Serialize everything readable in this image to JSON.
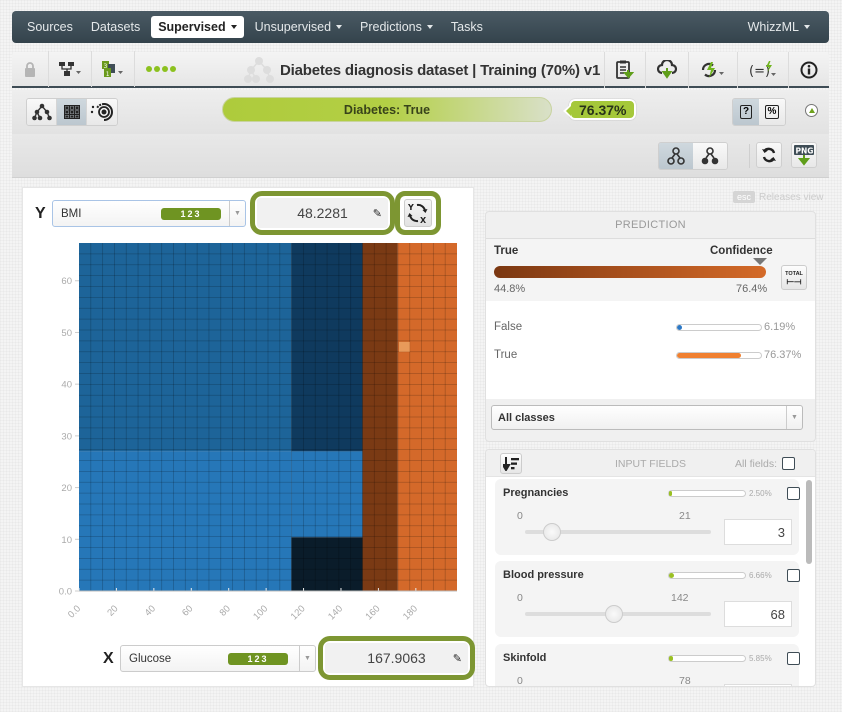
{
  "nav": {
    "items": [
      {
        "label": "Sources",
        "dropdown": false,
        "active": false
      },
      {
        "label": "Datasets",
        "dropdown": false,
        "active": false
      },
      {
        "label": "Supervised",
        "dropdown": true,
        "active": true
      },
      {
        "label": "Unsupervised",
        "dropdown": true,
        "active": false
      },
      {
        "label": "Predictions",
        "dropdown": true,
        "active": false
      },
      {
        "label": "Tasks",
        "dropdown": false,
        "active": false
      }
    ],
    "right_item": {
      "label": "WhizzML",
      "dropdown": true
    }
  },
  "toolbar": {
    "title": "Diabetes diagnosis dataset | Training (70%) v1",
    "left_icons": [
      "lock-icon",
      "network-icon",
      "counter-icon",
      "progress-dots-icon"
    ],
    "right_icons": [
      "report-download-icon",
      "cloud-download-icon",
      "lightning-cycle-icon",
      "formula-lightning-icon",
      "info-icon"
    ]
  },
  "prediction_header": {
    "label": "Diabetes: True",
    "confidence": "76.37%",
    "accent": "#a5c83a"
  },
  "view_buttons": [
    "tree-view",
    "heatmap-view",
    "sunburst-view"
  ],
  "y_axis": {
    "letter": "Y",
    "field": "BMI",
    "badge": "123",
    "value": "48.2281"
  },
  "x_axis": {
    "letter": "X",
    "field": "Glucose",
    "badge": "123",
    "value": "167.9063"
  },
  "esc_hint": {
    "key": "esc",
    "label": "Releases view"
  },
  "prediction": {
    "title": "PREDICTION",
    "class_label": "True",
    "confidence_label": "Confidence",
    "conf_low": "44.8%",
    "conf_high": "76.4%",
    "total_label": "TOTAL",
    "classes": [
      {
        "name": "False",
        "pct_text": "6.19%",
        "value": 6.19,
        "color": "#2b78c6"
      },
      {
        "name": "True",
        "pct_text": "76.37%",
        "value": 76.37,
        "color": "#f08030"
      }
    ],
    "class_filter": "All classes"
  },
  "inputs": {
    "title": "INPUT FIELDS",
    "all_fields_label": "All fields:",
    "fields": [
      {
        "name": "Pregnancies",
        "importance_text": "2.50%",
        "importance": 2.5,
        "min": "0",
        "max": "21",
        "value": "3",
        "slider_fraction": 0.143
      },
      {
        "name": "Blood pressure",
        "importance_text": "6.66%",
        "importance": 6.66,
        "min": "0",
        "max": "142",
        "value": "68",
        "slider_fraction": 0.479
      },
      {
        "name": "Skinfold",
        "importance_text": "5.85%",
        "importance": 5.85,
        "min": "0",
        "max": "78",
        "value": "",
        "slider_fraction": 0.3
      }
    ]
  },
  "chart_data": {
    "type": "heatmap",
    "title": "",
    "xlabel": "Glucose",
    "ylabel": "BMI",
    "xlim": [
      0,
      202
    ],
    "ylim": [
      0,
      67.3
    ],
    "x_ticks": [
      "0.0",
      "20",
      "40",
      "60",
      "80",
      "100",
      "120",
      "140",
      "160",
      "180"
    ],
    "x_tick_values": [
      0,
      20,
      40,
      60,
      80,
      100,
      120,
      140,
      160,
      180
    ],
    "y_ticks": [
      "0.0",
      "10",
      "20",
      "30",
      "40",
      "50",
      "60"
    ],
    "y_tick_values": [
      0,
      10,
      20,
      30,
      40,
      50,
      60
    ],
    "grid_cells_x": 32,
    "grid_cells_y": 32,
    "regions": [
      {
        "x0": 0,
        "x1": 113.5,
        "y0": 27,
        "y1": 67.3,
        "prediction": "False",
        "color": "#1d6499"
      },
      {
        "x0": 0,
        "x1": 113.5,
        "y0": 0,
        "y1": 27,
        "prediction": "False",
        "color": "#2677b8"
      },
      {
        "x0": 113.5,
        "x1": 151.5,
        "y0": 27,
        "y1": 67.3,
        "prediction": "False",
        "color": "#0f3a5e"
      },
      {
        "x0": 113.5,
        "x1": 151.5,
        "y0": 10.4,
        "y1": 27,
        "prediction": "False",
        "color": "#2677b8"
      },
      {
        "x0": 113.5,
        "x1": 151.5,
        "y0": 0,
        "y1": 10.4,
        "prediction": "False",
        "color": "#0a1c2a"
      },
      {
        "x0": 151.5,
        "x1": 170.3,
        "y0": 0,
        "y1": 67.3,
        "prediction": "True",
        "color": "#7a3a14"
      },
      {
        "x0": 170.3,
        "x1": 202,
        "y0": 0,
        "y1": 67.3,
        "prediction": "True",
        "color": "#d4692a"
      }
    ],
    "selected_point": {
      "x": 167.9063,
      "y": 48.2281,
      "color": "#e89a5a"
    },
    "legend": "none"
  }
}
